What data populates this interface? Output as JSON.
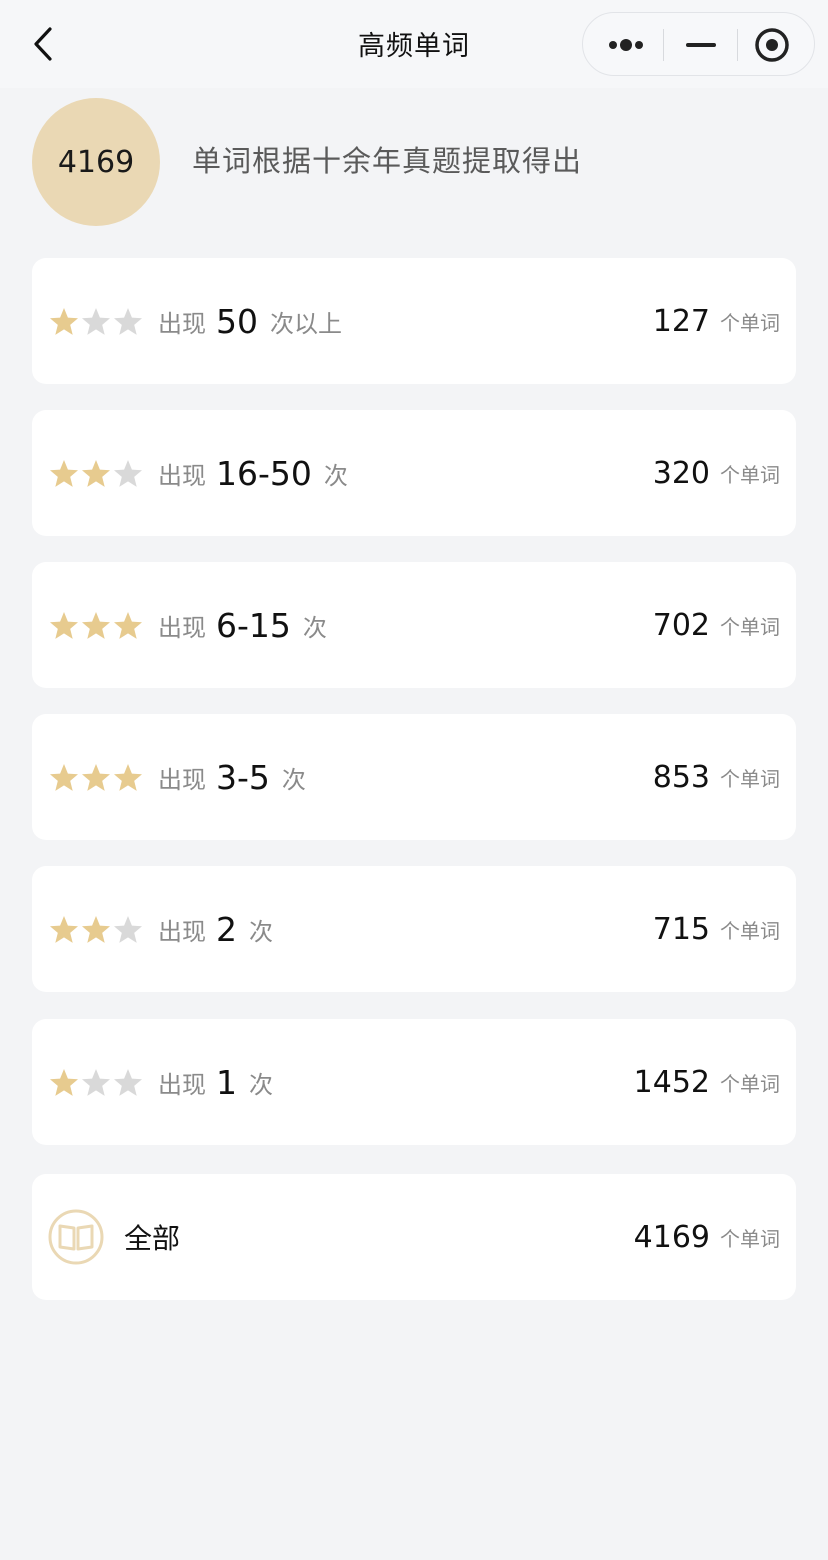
{
  "nav": {
    "title": "高频单词"
  },
  "summary": {
    "total": "4169",
    "description": "单词根据十余年真题提取得出"
  },
  "colors": {
    "accent": "#e7cb8f",
    "star_empty": "#d9d9d9",
    "circle_bg": "#ead8b4"
  },
  "rows": [
    {
      "prefix": "出现",
      "freq": "50",
      "suffix": "次以上",
      "count": "127",
      "unit": "个单词",
      "stars_filled": 1
    },
    {
      "prefix": "出现",
      "freq": "16-50",
      "suffix": "次",
      "count": "320",
      "unit": "个单词",
      "stars_filled": 2
    },
    {
      "prefix": "出现",
      "freq": "6-15",
      "suffix": "次",
      "count": "702",
      "unit": "个单词",
      "stars_filled": 3
    },
    {
      "prefix": "出现",
      "freq": "3-5",
      "suffix": "次",
      "count": "853",
      "unit": "个单词",
      "stars_filled": 3
    },
    {
      "prefix": "出现",
      "freq": "2",
      "suffix": "次",
      "count": "715",
      "unit": "个单词",
      "stars_filled": 2
    },
    {
      "prefix": "出现",
      "freq": "1",
      "suffix": "次",
      "count": "1452",
      "unit": "个单词",
      "stars_filled": 1
    }
  ],
  "all": {
    "label": "全部",
    "count": "4169",
    "unit": "个单词",
    "icon": "book-icon"
  }
}
